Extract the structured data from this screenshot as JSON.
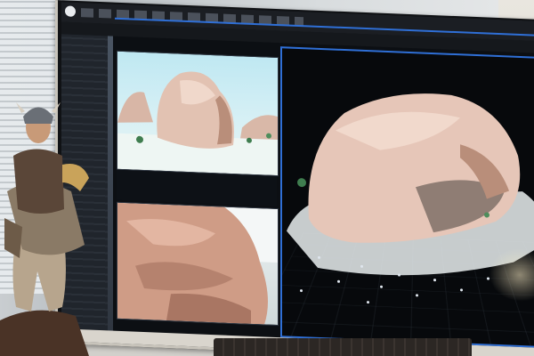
{
  "scene": {
    "description_tag": "photo-of-monitor",
    "colors": {
      "accent_blue": "#2f6fd6",
      "rock_light": "#e6c6b8",
      "rock_shadow": "#b98e7a",
      "sky": "#bfe8f2",
      "viewport_bg": "#07090c"
    }
  },
  "icons": {
    "app_logo": "app-logo-icon"
  }
}
